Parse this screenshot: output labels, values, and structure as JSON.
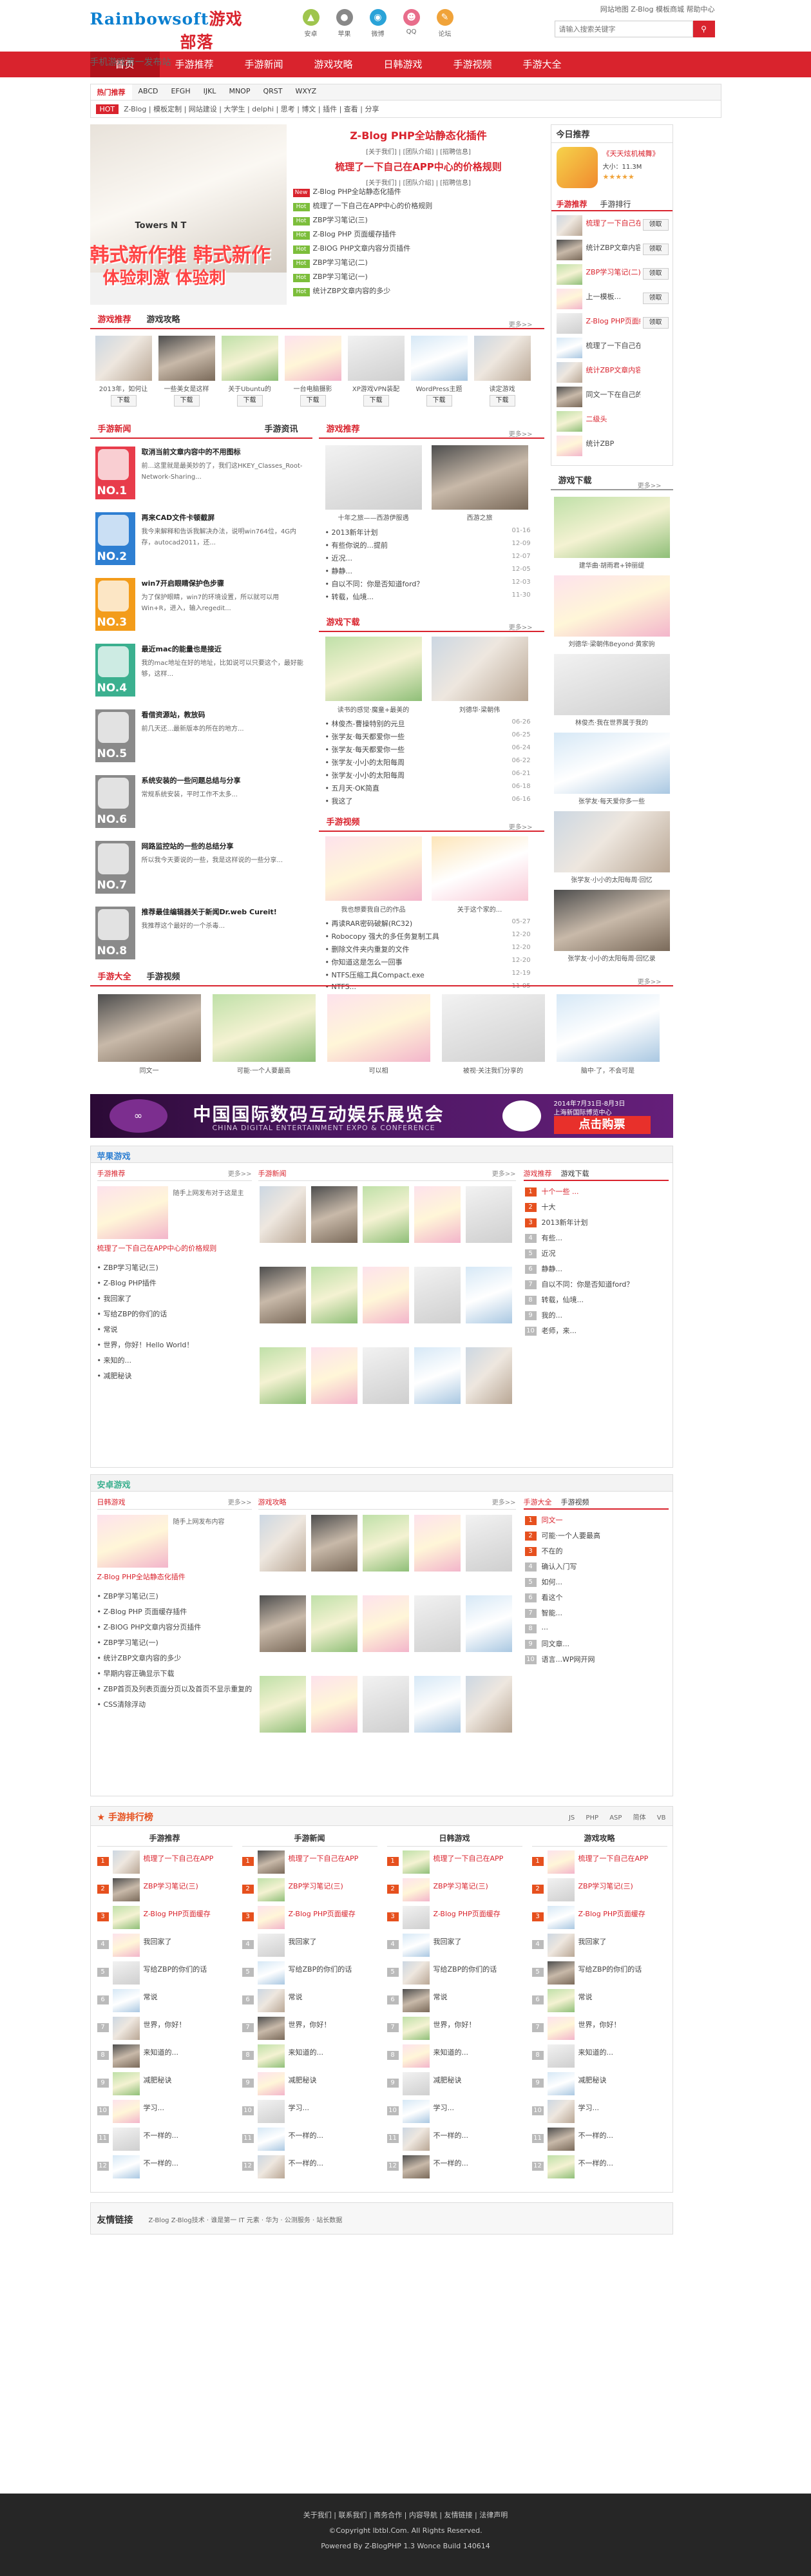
{
  "brand": {
    "logo_a": "Rainbowsoft",
    "logo_b": "游戏",
    "logo_c": "部落",
    "slogan": "手机游戏第一发布站"
  },
  "header_icons": [
    "安卓",
    "苹果",
    "微博",
    "QQ",
    "论坛"
  ],
  "toplinks": "网站地图  Z-Blog  模板商城  帮助中心",
  "search": {
    "placeholder": "请输入搜索关键字"
  },
  "nav": [
    "首页",
    "手游推荐",
    "手游新闻",
    "游戏攻略",
    "日韩游戏",
    "手游视频",
    "手游大全"
  ],
  "subnav": {
    "tabs": [
      "热门推荐",
      "ABCD",
      "EFGH",
      "IJKL",
      "MNOP",
      "QRST",
      "WXYZ"
    ],
    "hot": "HOT",
    "keywords": "Z-Blog | 模板定制 | 网站建设 | 大学生 | delphi | 思考 | 博文 | 插件 | 查看 | 分享"
  },
  "slider": {
    "text1": "韩式新作推 韩式新作",
    "text2": "体验刺激 体验刺",
    "caption": "Towers N T"
  },
  "headline": {
    "title": "Z-Blog PHP全站静态化插件",
    "sub1": "[关于我们] | [团队介绍] | [招聘信息]",
    "title2": "梳理了一下自己在APP中心的价格规则",
    "sub2": "[关于我们] | [团队介绍] | [招聘信息]"
  },
  "news_list": [
    "Z-Blog PHP全站静态化插件",
    "梳理了一下自己在APP中心的价格规则",
    "ZBP学习笔记(三)",
    "Z-Blog PHP 页面缓存插件",
    "Z-BlOG PHP文章内容分页插件",
    "ZBP学习笔记(二)",
    "ZBP学习笔记(一)",
    "统计ZBP文章内容的多少"
  ],
  "today": {
    "title": "今日推荐",
    "app": "《天天炫机械舞》",
    "size": "大小：11.3M",
    "rating": "★★★★★"
  },
  "hot_tabs": [
    "手游推荐",
    "手游排行"
  ],
  "hot_list": [
    "梳理了一下自己在APP",
    "统计ZBP文章内容",
    "ZBP学习笔记(二)",
    "上一模板...",
    "Z-Blog PHP页面缓存",
    "梳理了一下自己在APP",
    "统计ZBP文章内容",
    "同文一下在自己的",
    "二级头",
    "统计ZBP"
  ],
  "hot_btn": "领取",
  "row1_tabs": [
    "游戏推荐",
    "游戏攻略"
  ],
  "row1_items": [
    "2013年，如何让",
    "一些美女是这样",
    "关于Ubuntu的",
    "一台电脑摄影",
    "XP游戏VPN装配",
    "WordPress主题",
    "读定游戏"
  ],
  "dl": "下载",
  "left_tabs": [
    "手游新闻",
    "手游资讯"
  ],
  "rank_items": [
    {
      "t": "取消当前文章内容中的不用图标",
      "d": "前...这里就是最美妙的了，我们这HKEY_Classes_Root-Network-Sharing..."
    },
    {
      "t": "再来CAD文件卡顿截屏",
      "d": "我今来解释和告诉我解决办法，说明win764位，4G内存，autocad2011，还..."
    },
    {
      "t": "win7开启眼睛保护色步骤",
      "d": "为了保护眼睛，win7的环境设置，所以就可以用Win+R，进入，输入regedit..."
    },
    {
      "t": "最近mac的能量也是接近",
      "d": "我的mac地址在好的地址，比如说可以只要这个，最好能够，这样..."
    },
    {
      "t": "看借资源站，教放码",
      "d": "前几天还...最新版本的所在的地方..."
    },
    {
      "t": "系统安装的一些问题总结与分享",
      "d": "常规系统安装，平时工作不太多..."
    },
    {
      "t": "网路监控站的一些的总结分享",
      "d": "所以我今天要说的一些，我是这样说的一些分享..."
    },
    {
      "t": "推荐最佳编辑器关于新闻Dr.web Cureit!",
      "d": "我推荐这个最好的一个杀毒..."
    }
  ],
  "mid_tabs": [
    "游戏推荐",
    "更多>>"
  ],
  "mid_caps": [
    "十年之旅——西游伊服遇",
    "西游之旅"
  ],
  "mid_list": [
    "2013新年计划",
    "有些你说的...提前",
    "近况...",
    "静静...",
    "自以不同：你是否知道ford？",
    "转载，仙境..."
  ],
  "mid_dates": [
    "01-16",
    "12-09",
    "12-07",
    "12-05",
    "12-03",
    "11-30"
  ],
  "mid2_caps": [
    "读书的感觉·魔童+最美的",
    "刘德华·梁朝伟"
  ],
  "mid2_list": [
    "林俊杰-曹操特别的元旦",
    "张学友·每天都爱你一些",
    "张学友·每天都爱你一些",
    "张学友·小小的太阳每周",
    "张学友·小小的太阳每周",
    "五月天·OK简直",
    "我这了"
  ],
  "mid2_dates": [
    "06-26",
    "06-25",
    "06-24",
    "06-22",
    "06-21",
    "06-18",
    "06-16"
  ],
  "mid3_caps": [
    "我也想要我自己的作品",
    "关于这个家的..."
  ],
  "mid3_list": [
    "再读RAR密码破解(RC32)",
    "Robocopy 强大的多任务复制工具",
    "删除文件夹内重复的文件",
    "你知道这是怎么一回事",
    "NTFS压缩工具Compact.exe",
    "NTFS..."
  ],
  "mid3_dates": [
    "05-27",
    "12-20",
    "12-20",
    "12-20",
    "12-19",
    "11-05"
  ],
  "video_title": "游戏下载",
  "video_caps": [
    "建华曲·胡雨君+钟丽缇",
    "刘德华·梁朝伟Beyond·黄家驹",
    "林俊杰·我在世界属于我的",
    "张学友·每天爱你多一些",
    "张学友·小小的太阳每周·回忆",
    "张学友·小小的太阳每周·回忆录"
  ],
  "gallery_tabs": [
    "手游大全",
    "手游视频"
  ],
  "gallery_caps": [
    "同文一",
    "可能·一个人要最高",
    "可以相",
    "被视·关注我们分享的",
    "脑中·了，不会可是"
  ],
  "banner": {
    "big": "中国国际数码互动娱乐展览会",
    "en": "CHINA DIGITAL ENTERTAINMENT EXPO & CONFERENCE",
    "date": "2014年7月31日-8月3日",
    "place": "上海新国际博览中心",
    "cta": "点击购票"
  },
  "s1": {
    "title": "苹果游戏",
    "col1": "手游推荐",
    "col2": "手游新闻",
    "col3a": "游戏推荐",
    "col3b": "游戏下载",
    "feature": "梳理了一下自己在APP中心的价格规则",
    "feature_d": "随手上网发布对于这是主",
    "list": [
      "ZBP学习笔记(三)",
      "Z-Blog PHP插件",
      "我回家了",
      "写给ZBP的你们的话",
      "常说",
      "世界，你好！Hello World！",
      "来知的...",
      "减肥秘诀"
    ],
    "rank": [
      "十个一些 ...",
      "十大",
      "2013新年计划",
      "有些...",
      "近况",
      "静静...",
      "自以不同：你是否知道ford？",
      "转载，仙境...",
      "我的...",
      "老师，来..."
    ]
  },
  "s2": {
    "title": "安卓游戏",
    "col1": "日韩游戏",
    "col2": "游戏攻略",
    "col3a": "手游大全",
    "col3b": "手游视频",
    "feature": "Z-Blog PHP全站静态化插件",
    "feature_d": "随手上网发布内容",
    "list": [
      "ZBP学习笔记(三)",
      "Z-Blog PHP 页面缓存插件",
      "Z-BlOG PHP文章内容分页插件",
      "ZBP学习笔记(一)",
      "统计ZBP文章内容的多少",
      "早期内容正确显示下载",
      "ZBP首页及列表页面分页以及首页不显示重复的",
      "CSS清除浮动"
    ],
    "rank": [
      "同文一",
      "可能·一个人要最高",
      "不在的",
      "确认入门写",
      "如何...",
      "看这个",
      "智能...",
      "...",
      "同文章...",
      "语言...WP网开网"
    ]
  },
  "ranks": {
    "title": "手游排行榜",
    "tabs": [
      "JS",
      "PHP",
      "ASP",
      "简体",
      "VB"
    ],
    "cols": [
      "手游推荐",
      "手游新闻",
      "日韩游戏",
      "游戏攻略"
    ]
  },
  "rankcol": [
    "梳理了一下自己在APP",
    "ZBP学习笔记(三)",
    "Z-Blog PHP页面缓存",
    "我回家了",
    "写给ZBP的你们的话",
    "常说",
    "世界，你好！",
    "来知道的...",
    "减肥秘诀",
    "学习...",
    "不一样的...",
    "不一样的..."
  ],
  "friends": {
    "title": "友情链接",
    "links": "Z-Blog  Z-Blog技术 · 谁是第一  IT 元素  ·  华为  ·  公测服务 · 站长数据"
  },
  "footer": {
    "links": "关于我们 | 联系我们 | 商务合作 | 内容导航 | 友情链接 | 法律声明",
    "copy": "©Copyright  lbtbl.Com. All Rights Reserved.",
    "power": "Powered By Z-BlogPHP 1.3 Wonce Build 140614"
  }
}
